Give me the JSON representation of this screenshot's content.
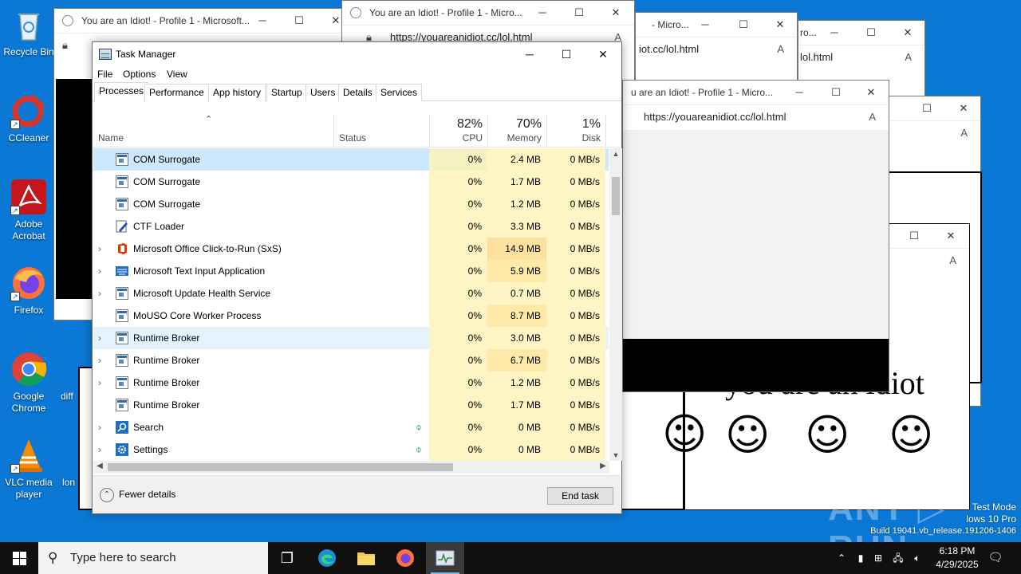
{
  "desktop": {
    "icons": [
      {
        "label": "Recycle Bin",
        "icon": "recycle-bin-icon"
      },
      {
        "label": "CCleaner",
        "icon": "ccleaner-icon"
      },
      {
        "label": "Adobe Acrobat",
        "icon": "acrobat-icon"
      },
      {
        "label": "Firefox",
        "icon": "firefox-icon"
      },
      {
        "label": "Google Chrome",
        "icon": "chrome-icon"
      },
      {
        "label": "VLC media player",
        "icon": "vlc-icon"
      }
    ],
    "partial_labels": [
      "diff",
      "lon"
    ]
  },
  "browser_windows": {
    "title": "You are an Idiot! - Profile 1 - Microsoft...",
    "title_short": "You are an Idiot! - Profile 1 - Micro...",
    "title_short2": "- Micro...",
    "title_short3": "u are an Idiot! - Profile 1 - Micro...",
    "title_short4": "ro...",
    "url": "https://youareanidiot.cc/lol.html",
    "url_partial1": "iot.cc/lol.html",
    "url_partial2": "lol.html",
    "idiot_text": "you are an idiot",
    "smiley": "☺"
  },
  "task_manager": {
    "title": "Task Manager",
    "menu": [
      "File",
      "Options",
      "View"
    ],
    "tabs": [
      "Processes",
      "Performance",
      "App history",
      "Startup",
      "Users",
      "Details",
      "Services"
    ],
    "active_tab": "Processes",
    "columns": {
      "name": "Name",
      "status": "Status",
      "cpu_pct": "82%",
      "cpu": "CPU",
      "memory_pct": "70%",
      "memory": "Memory",
      "disk_pct": "1%",
      "disk": "Disk"
    },
    "processes": [
      {
        "name": "COM Surrogate",
        "expandable": false,
        "cpu": "0%",
        "memory": "2.4 MB",
        "disk": "0 MB/s",
        "icon": "app-window-icon"
      },
      {
        "name": "COM Surrogate",
        "expandable": false,
        "cpu": "0%",
        "memory": "1.7 MB",
        "disk": "0 MB/s",
        "icon": "app-window-icon"
      },
      {
        "name": "COM Surrogate",
        "expandable": false,
        "cpu": "0%",
        "memory": "1.2 MB",
        "disk": "0 MB/s",
        "icon": "app-window-icon"
      },
      {
        "name": "CTF Loader",
        "expandable": false,
        "cpu": "0%",
        "memory": "3.3 MB",
        "disk": "0 MB/s",
        "icon": "pen-icon"
      },
      {
        "name": "Microsoft Office Click-to-Run (SxS)",
        "expandable": true,
        "cpu": "0%",
        "memory": "14.9 MB",
        "disk": "0 MB/s",
        "icon": "office-icon"
      },
      {
        "name": "Microsoft Text Input Application",
        "expandable": true,
        "cpu": "0%",
        "memory": "5.9 MB",
        "disk": "0 MB/s",
        "icon": "keyboard-icon"
      },
      {
        "name": "Microsoft Update Health Service",
        "expandable": true,
        "cpu": "0%",
        "memory": "0.7 MB",
        "disk": "0 MB/s",
        "icon": "app-window-icon"
      },
      {
        "name": "MoUSO Core Worker Process",
        "expandable": false,
        "cpu": "0%",
        "memory": "8.7 MB",
        "disk": "0 MB/s",
        "icon": "app-window-icon"
      },
      {
        "name": "Runtime Broker",
        "expandable": true,
        "cpu": "0%",
        "memory": "3.0 MB",
        "disk": "0 MB/s",
        "icon": "app-window-icon"
      },
      {
        "name": "Runtime Broker",
        "expandable": true,
        "cpu": "0%",
        "memory": "6.7 MB",
        "disk": "0 MB/s",
        "icon": "app-window-icon"
      },
      {
        "name": "Runtime Broker",
        "expandable": true,
        "cpu": "0%",
        "memory": "1.2 MB",
        "disk": "0 MB/s",
        "icon": "app-window-icon"
      },
      {
        "name": "Runtime Broker",
        "expandable": false,
        "cpu": "0%",
        "memory": "1.7 MB",
        "disk": "0 MB/s",
        "icon": "app-window-icon"
      },
      {
        "name": "Search",
        "expandable": true,
        "cpu": "0%",
        "memory": "0 MB",
        "disk": "0 MB/s",
        "icon": "search-icon",
        "suspended": true
      },
      {
        "name": "Settings",
        "expandable": true,
        "cpu": "0%",
        "memory": "0 MB",
        "disk": "0 MB/s",
        "icon": "gear-icon",
        "suspended": true
      }
    ],
    "fewer_details": "Fewer details",
    "end_task": "End task"
  },
  "taskbar": {
    "search_placeholder": "Type here to search",
    "time": "6:18 PM",
    "date": "4/29/2025"
  },
  "watermark": {
    "line1": "Test Mode",
    "line2": "lows 10 Pro",
    "line3": "Build 19041.vb_release.191206-1406",
    "brand": "ANY.RUN"
  }
}
